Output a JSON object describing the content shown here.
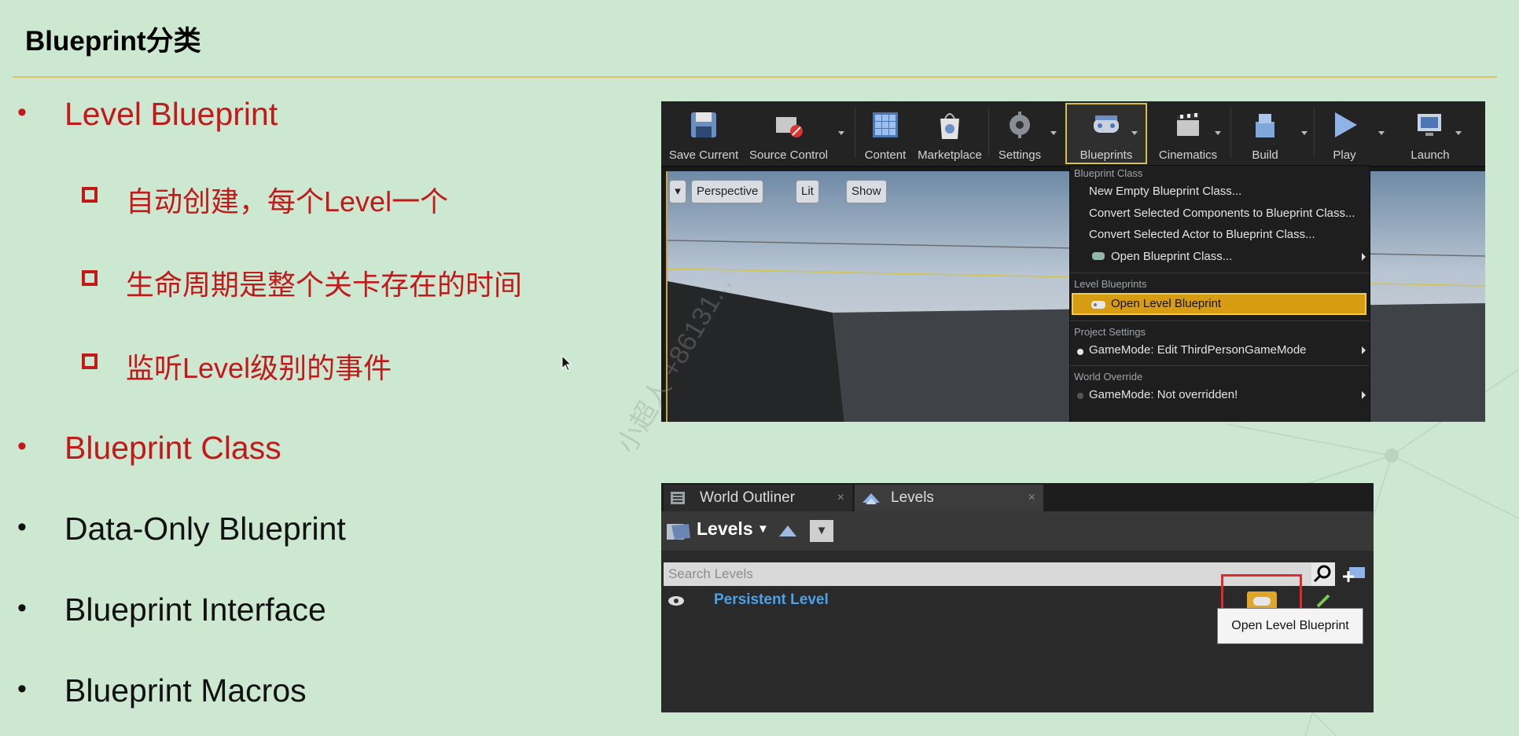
{
  "slide": {
    "title": "Blueprint分类",
    "bullets": [
      {
        "text": "Level Blueprint",
        "red": true
      },
      {
        "text": "Blueprint Class",
        "red": true
      },
      {
        "text": "Data-Only Blueprint",
        "red": false
      },
      {
        "text": "Blueprint Interface",
        "red": false
      },
      {
        "text": "Blueprint Macros",
        "red": false
      }
    ],
    "sub_bullets": [
      "自动创建，每个Level一个",
      "生命周期是整个关卡存在的时间",
      "监听Level级别的事件"
    ],
    "bullet_glyph": "•",
    "watermark": "小超人 +86131..."
  },
  "editor_toolbar": {
    "buttons": [
      "Save Current",
      "Source Control",
      "Content",
      "Marketplace",
      "Settings",
      "Blueprints",
      "Cinematics",
      "Build",
      "Play",
      "Launch"
    ],
    "selected": "Blueprints"
  },
  "viewport": {
    "buttons": [
      "Perspective",
      "Lit",
      "Show"
    ]
  },
  "blueprints_menu": {
    "section_blueprint_class": "Blueprint Class",
    "item_new_empty": "New Empty Blueprint Class...",
    "item_convert_components": "Convert Selected Components to Blueprint Class...",
    "item_convert_actor": "Convert Selected Actor to Blueprint Class...",
    "item_open_class": "Open Blueprint Class...",
    "section_level_blueprints": "Level Blueprints",
    "item_open_level": "Open Level Blueprint",
    "section_project_settings": "Project Settings",
    "item_gamemode_edit": "GameMode: Edit ThirdPersonGameMode",
    "section_world_override": "World Override",
    "item_gamemode_not_overridden": "GameMode: Not overridden!"
  },
  "levels_panel": {
    "tab_world_outliner": "World Outliner",
    "tab_levels": "Levels",
    "tab_close": "×",
    "levels_menu": "Levels",
    "search_placeholder": "Search Levels",
    "persistent_level": "Persistent Level",
    "tooltip": "Open Level Blueprint"
  },
  "colors": {
    "background": "#cde8d1",
    "accent_red": "#c21a1a",
    "rule": "#e0c16e",
    "highlight": "#d89c12",
    "level_link": "#4aa3e8"
  }
}
